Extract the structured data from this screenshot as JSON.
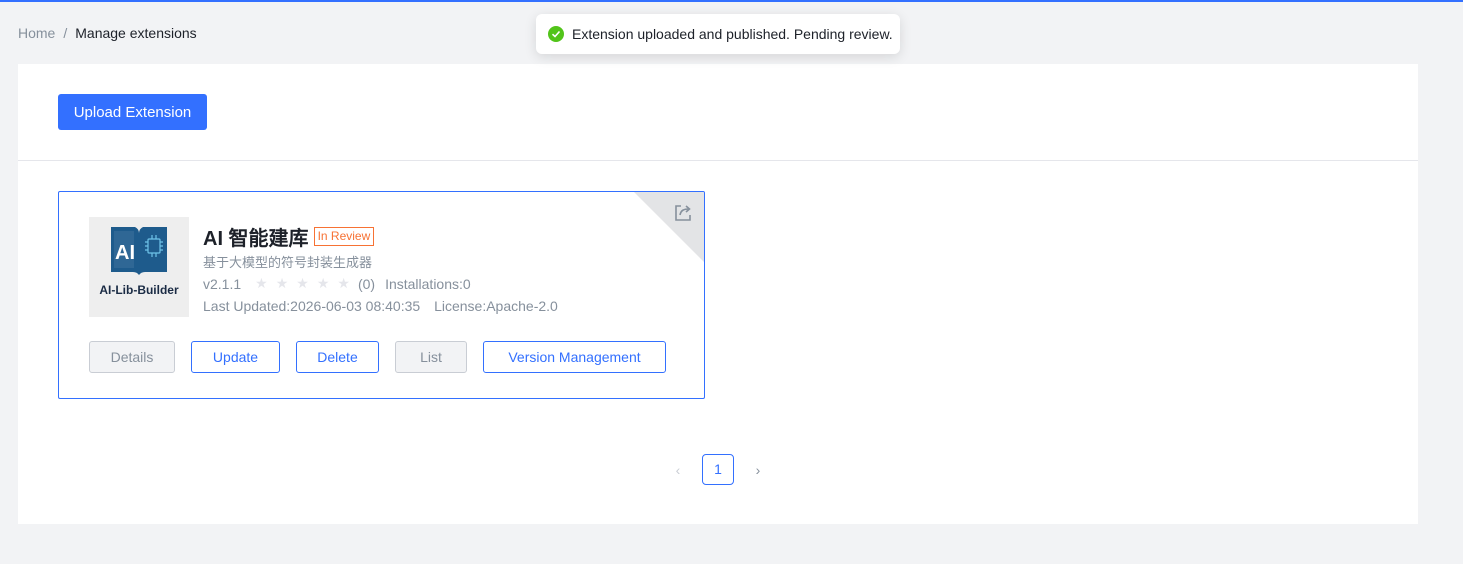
{
  "colors": {
    "accent": "#3370ff",
    "review_badge": "#f77234",
    "success": "#52c41a"
  },
  "breadcrumb": {
    "home": "Home",
    "separator": "/",
    "current": "Manage extensions"
  },
  "toast": {
    "message": "Extension uploaded and published. Pending review.",
    "icon": "success-check-icon"
  },
  "toolbar": {
    "upload_label": "Upload Extension"
  },
  "extension": {
    "logo_text": "AI",
    "logo_caption": "AI-Lib-Builder",
    "title": "AI 智能建库",
    "status": "In Review",
    "description": "基于大模型的符号封装生成器",
    "version": "v2.1.1",
    "rating": 0,
    "rating_count": "(0)",
    "installations": "Installations:0",
    "last_updated": "Last Updated:2026-06-03 08:40:35",
    "license": "License:Apache-2.0",
    "actions": {
      "details": "Details",
      "update": "Update",
      "delete": "Delete",
      "list": "List",
      "version_management": "Version Management"
    }
  },
  "pagination": {
    "prev": "‹",
    "current": "1",
    "next": "›"
  }
}
